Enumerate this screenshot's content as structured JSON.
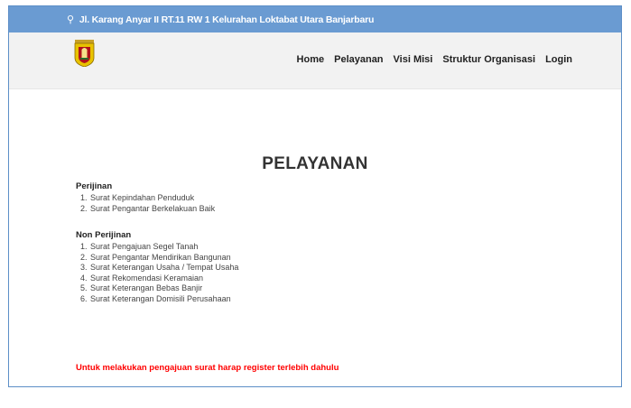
{
  "topbar": {
    "icon": "map-pin-icon",
    "address": "Jl. Karang Anyar II RT.11 RW 1 Kelurahan Loktabat Utara Banjarbaru"
  },
  "brand": {
    "logo": "banjarbaru-crest-logo"
  },
  "nav": {
    "home": "Home",
    "pelayanan": "Pelayanan",
    "visi_misi": "Visi Misi",
    "struktur": "Struktur Organisasi",
    "login": "Login"
  },
  "page": {
    "title": "PELAYANAN",
    "perijinan": {
      "heading": "Perijinan",
      "items": [
        "Surat Kepindahan Penduduk",
        "Surat Pengantar Berkelakuan Baik"
      ]
    },
    "non_perijinan": {
      "heading": "Non Perijinan",
      "items": [
        "Surat Pengajuan Segel Tanah",
        "Surat Pengantar Mendirikan Bangunan",
        "Surat Keterangan Usaha / Tempat Usaha",
        "Surat Rekomendasi Keramaian",
        "Surat Keterangan Bebas Banjir",
        "Surat Keterangan Domisili Perusahaan"
      ]
    },
    "notice": "Untuk melakukan pengajuan surat harap register terlebih dahulu"
  },
  "colors": {
    "topbar": "#6a9bd2",
    "notice": "#ff0000",
    "navbar": "#f2f2f2"
  }
}
